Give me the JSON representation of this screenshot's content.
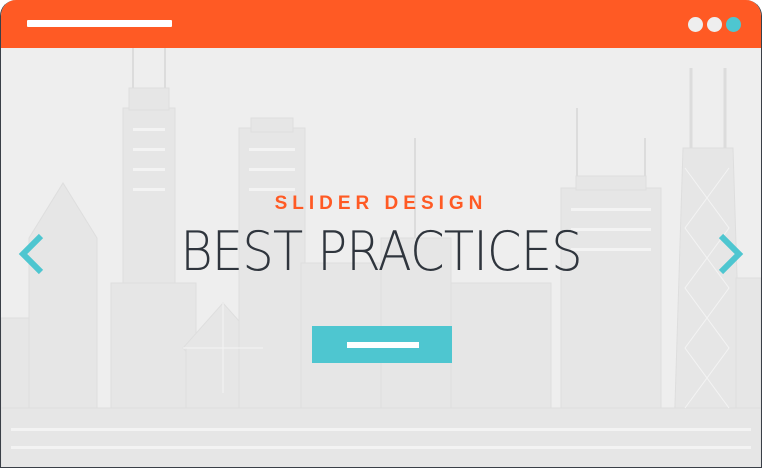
{
  "slider": {
    "eyebrow": "SLIDER DESIGN",
    "headline": "BEST PRACTICES"
  },
  "icons": {
    "prev": "chevron-left-icon",
    "next": "chevron-right-icon"
  },
  "colors": {
    "titlebar": "#ff5a24",
    "accent": "#4ec6d0",
    "eyebrow": "#ff5a24",
    "headline": "#2f353d",
    "background": "#eeeeee",
    "window_dots": [
      "#eeeeee",
      "#eeeeee",
      "#4ec6d0"
    ]
  }
}
